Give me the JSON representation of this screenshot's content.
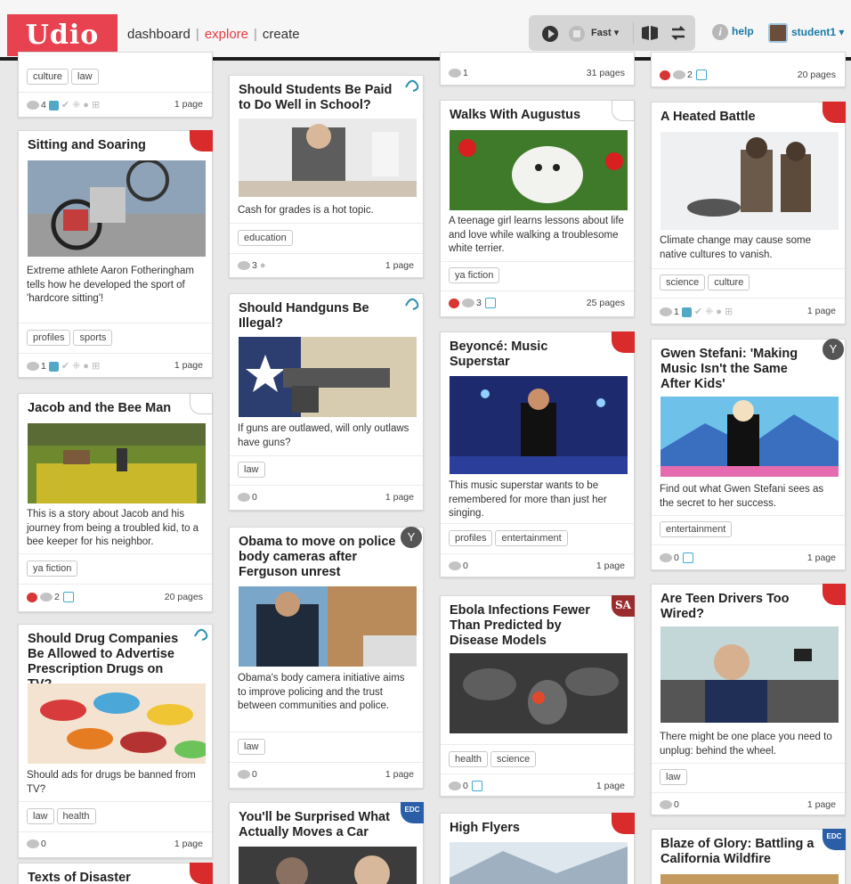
{
  "app": {
    "logo": "Udio",
    "nav": [
      {
        "label": "dashboard",
        "active": false
      },
      {
        "label": "explore",
        "active": true
      },
      {
        "label": "create",
        "active": false
      }
    ],
    "speed_label": "Fast",
    "help_label": "help",
    "user_label": "student1",
    "colors": {
      "brand": "#e8414f",
      "link": "#1a7aa5",
      "accent_tab": "#e43a42"
    }
  },
  "cards": {
    "c1": {
      "tags": [
        "culture",
        "law"
      ],
      "comments": "4",
      "pages": "1 page"
    },
    "c2": {
      "title": "Sitting and Soaring",
      "desc": "Extreme athlete Aaron Fotheringham tells how he developed the sport of 'hardcore sitting'!",
      "tags": [
        "profiles",
        "sports"
      ],
      "comments": "1",
      "pages": "1 page"
    },
    "c3": {
      "title": "Jacob and the Bee Man",
      "desc": "This is a story about Jacob and his journey from being a troubled kid, to a bee keeper for his neighbor.",
      "tags": [
        "ya fiction"
      ],
      "comments": "2",
      "pages": "20 pages"
    },
    "c4": {
      "title": "Should Drug Companies Be Allowed to Advertise Prescription Drugs on TV?",
      "desc": "Should ads for drugs be banned from TV?",
      "tags": [
        "law",
        "health"
      ],
      "comments": "0",
      "pages": "1 page"
    },
    "c5": {
      "title": "Texts of Disaster"
    },
    "c6": {
      "title": "Should Students Be Paid to Do Well in School?",
      "desc": "Cash for grades is a hot topic.",
      "tags": [
        "education"
      ],
      "comments": "3",
      "pages": "1 page"
    },
    "c7": {
      "title": "Should Handguns Be Illegal?",
      "desc": "If guns are outlawed, will only outlaws have guns?",
      "tags": [
        "law"
      ],
      "comments": "0",
      "pages": "1 page"
    },
    "c8": {
      "title": "Obama to move on police body cameras after Ferguson unrest",
      "desc": "Obama's body camera initiative aims to improve policing and the trust between communities and police.",
      "tags": [
        "law"
      ],
      "comments": "0",
      "pages": "1 page"
    },
    "c9": {
      "title": "You'll be Surprised What Actually Moves a Car"
    },
    "c10": {
      "comments": "1",
      "pages": "31 pages"
    },
    "c11": {
      "title": "Walks With Augustus",
      "desc": "A teenage girl learns lessons about life and love while walking a troublesome white terrier.",
      "tags": [
        "ya fiction"
      ],
      "comments": "3",
      "pages": "25 pages"
    },
    "c12": {
      "title": "Beyoncé: Music Superstar",
      "desc": "This music superstar wants to be remembered for more than just her singing.",
      "tags": [
        "profiles",
        "entertainment"
      ],
      "comments": "0",
      "pages": "1 page"
    },
    "c13": {
      "title": "Ebola Infections Fewer Than Predicted by Disease Models",
      "tags": [
        "health",
        "science"
      ],
      "comments": "0",
      "pages": "1 page"
    },
    "c14": {
      "title": "High Flyers"
    },
    "c15": {
      "comments": "2",
      "pages": "20 pages"
    },
    "c16": {
      "title": "A Heated Battle",
      "desc": "Climate change may cause some native cultures to vanish.",
      "tags": [
        "science",
        "culture"
      ],
      "comments": "1",
      "pages": "1 page"
    },
    "c17": {
      "title": "Gwen Stefani: 'Making Music Isn't the Same After Kids'",
      "desc": "Find out what Gwen Stefani sees as the secret to her success.",
      "tags": [
        "entertainment"
      ],
      "comments": "0",
      "pages": "1 page"
    },
    "c18": {
      "title": "Are Teen Drivers Too Wired?",
      "desc": "There might be one place you need to unplug: behind the wheel.",
      "tags": [
        "law"
      ],
      "comments": "0",
      "pages": "1 page"
    },
    "c19": {
      "title": "Blaze of Glory: Battling a California Wildfire"
    }
  }
}
